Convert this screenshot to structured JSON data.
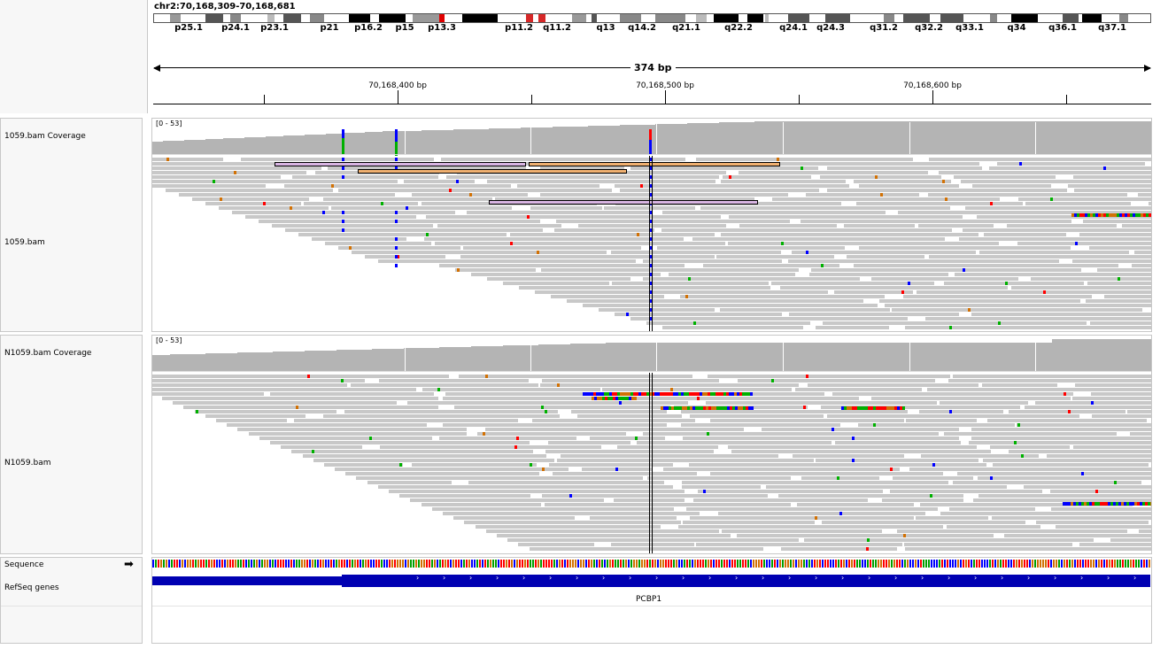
{
  "locus": "chr2:70,168,309-70,168,681",
  "span_label": "374 bp",
  "ruler_ticks": [
    "70,168,400 bp",
    "70,168,500 bp",
    "70,168,600 bp"
  ],
  "cytobands": [
    "p25.1",
    "p24.1",
    "p23.1",
    "p21",
    "p16.2",
    "p15",
    "p13.3",
    "p11.2",
    "q11.2",
    "q13",
    "q14.2",
    "q21.1",
    "q22.2",
    "q24.1",
    "q24.3",
    "q31.2",
    "q32.2",
    "q33.1",
    "q34",
    "q36.1",
    "q37.1"
  ],
  "tracks": {
    "cov1": "1059.bam Coverage",
    "bam1": "1059.bam",
    "cov2": "N1059.bam Coverage",
    "bam2": "N1059.bam",
    "sequence": "Sequence",
    "refseq": "RefSeq genes"
  },
  "cov_range": "[0 - 53]",
  "sequence_arrow": "➡",
  "gene_name": "PCBP1",
  "colors": {
    "read": "#c8c8c8",
    "coverage": "#b4b4b4",
    "gene": "#0000b2",
    "mismatch_A": "#00b000",
    "mismatch_C": "#0000ff",
    "mismatch_G": "#d17105",
    "mismatch_T": "#ff0000",
    "centromere": "#d62828"
  }
}
